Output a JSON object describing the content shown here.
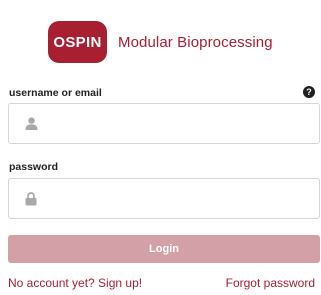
{
  "brand": {
    "logo_text": "OSPIN",
    "tagline": "Modular Bioprocessing",
    "color": "#a81f32"
  },
  "form": {
    "username_label": "username or email",
    "username_value": "",
    "username_placeholder": "",
    "username_icon": "user-icon",
    "help_icon": "question-circle-icon",
    "help_glyph": "?",
    "password_label": "password",
    "password_value": "",
    "password_placeholder": "",
    "password_icon": "lock-icon",
    "login_label": "Login",
    "login_color": "#d3a0a8"
  },
  "links": {
    "signup": "No account yet? Sign up!",
    "forgot": "Forgot password"
  }
}
